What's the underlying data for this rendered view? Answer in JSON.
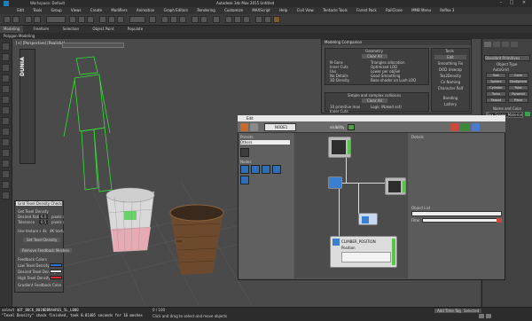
{
  "window": {
    "title": "Autodesk 3ds Max 2015   Untitled",
    "workspace": "Workspace: Default"
  },
  "menu": [
    "Edit",
    "Tools",
    "Group",
    "Views",
    "Create",
    "Modifiers",
    "Animation",
    "Graph Editors",
    "Rendering",
    "Customize",
    "MAXScript",
    "Help",
    "Civil View",
    "Tentacle Tools",
    "Forest Pack",
    "RailClone",
    "MMB Menu",
    "Reflex 3"
  ],
  "ribbon": {
    "tabs": [
      "Modeling",
      "Freeform",
      "Selection",
      "Object Paint",
      "Populate"
    ],
    "sub": "Polygon Modeling"
  },
  "viewport": {
    "label": "[+] [Perspective] [Realistic]"
  },
  "dunia": {
    "logo": "DUNIA"
  },
  "modeling_companion": {
    "title": "Modeling Companion",
    "section_geometry": "Geometry",
    "clear_all": "Clear All",
    "geo_items": [
      "N-Gons",
      "Inner Cuts",
      "Uvs",
      "No Details",
      "3D Density"
    ],
    "geo_items_right": [
      "Triangles allocation",
      "Optimized LOD",
      "Lower per objSel",
      "Good Smoothing",
      "Base shader on Lush LOD"
    ],
    "section_collisions": "Simple and complex collisions",
    "clear_all_2": "Clear All",
    "coll_items": [
      "10 primitive max",
      "Inner Cuts"
    ],
    "coll_items_right": [
      "Logic (Naked set)"
    ]
  },
  "tools_panel": {
    "title": "Tools",
    "items": [
      "Edit",
      "Smoothing Fix",
      "DOD Unwrap",
      "Tex2Density",
      "Ce Naming",
      "Character Rolf",
      "Banding",
      "Lattery"
    ]
  },
  "command_panel": {
    "dropdown": "Standard Primitives",
    "object_type": "Object Type",
    "autogrid": "AutoGrid",
    "buttons": [
      "Box",
      "Cone",
      "Sphere",
      "GeoSphere",
      "Cylinder",
      "Tube",
      "Torus",
      "Pyramid",
      "Teapot",
      "Plane"
    ],
    "name_color": "Name and Color",
    "name_value": "Box_Scene_Material"
  },
  "graph_editor": {
    "title": "Edit",
    "node_name": "NODE1",
    "visibility": "visibility",
    "presets_label": "Presets",
    "presets_value": "Others",
    "nodes_label": "Nodes",
    "details_label": "Details",
    "object_list_label": "Object List",
    "filter_label": "Filter",
    "position_node": "CLIMBER_POSITION",
    "position_sub": "Position"
  },
  "density_checker": {
    "title": "Grid Texel Density Checker",
    "get_texel": "Get Texel Density",
    "desired_ratio_label": "Desired Ratio",
    "desired_ratio_value": "6.0",
    "desired_ratio_unit": "pixels / cm",
    "tolerance_label": "Tolerance",
    "tolerance_value": "0.5",
    "tolerance_unit": "pixels / cm",
    "use_texture_label": "Use texture size",
    "width_value": "4k",
    "textures_label": "4K textures",
    "set_texel": "Set Texel Density",
    "remove_feedback": "Remove Feedback Meshes",
    "feedback_colors": "Feedback Colors",
    "low_label": "Low Texel Density",
    "desired_label": "Desired Texel Density",
    "high_label": "High Texel Density",
    "gradient_label": "Gradient Feedback Color",
    "low_color": "#2f6fd8",
    "desired_color": "#e8e8e8",
    "high_color": "#d92b2b"
  },
  "status": {
    "line1": "select $OT_BUCK_B01NDBRAARES_5L_L000",
    "line2": "\"Texel Density\" check finished, took 0.01405 seconds for 16 meshes",
    "frames": "0 / 100",
    "hint": "Click and drag to select and move objects",
    "selected": "Selected",
    "addtime": "Add Time Tag"
  }
}
